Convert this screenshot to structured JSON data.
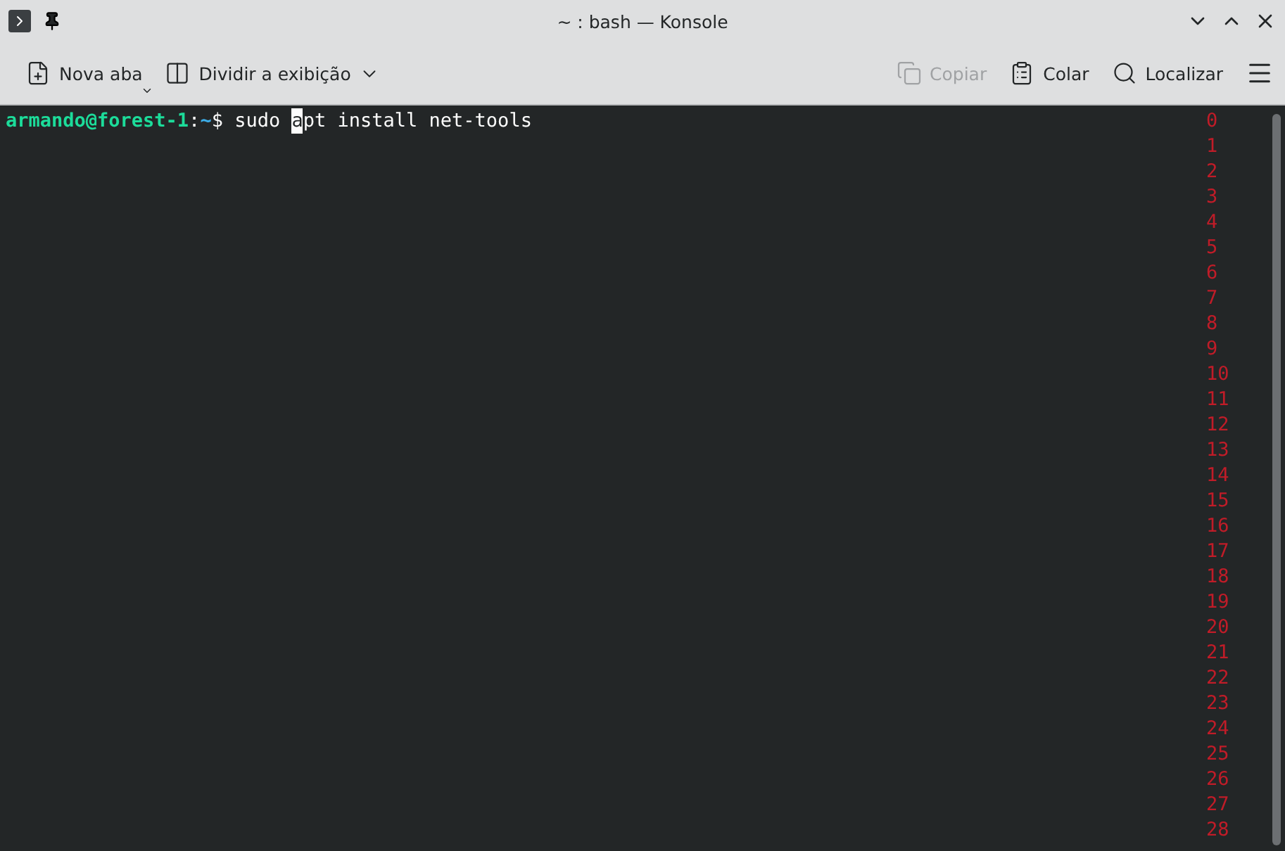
{
  "window": {
    "title": "~ : bash — Konsole"
  },
  "toolbar": {
    "left": [
      {
        "label": "Nova aba",
        "disabled": false,
        "kind": "corner"
      },
      {
        "label": "Dividir a exibição",
        "disabled": false,
        "kind": "side"
      }
    ],
    "right": [
      {
        "label": "Copiar",
        "disabled": true
      },
      {
        "label": "Colar",
        "disabled": false
      },
      {
        "label": "Localizar",
        "disabled": false
      }
    ]
  },
  "terminal": {
    "lines": [
      {
        "user_host": "armando@forest-1",
        "separator": ":",
        "path": "~",
        "symbol": "$",
        "before_cursor": " sudo ",
        "cursor_char": "a",
        "after_cursor": "pt install net-tools"
      }
    ],
    "row_numbers": [
      "0",
      "1",
      "2",
      "3",
      "4",
      "5",
      "6",
      "7",
      "8",
      "9",
      "10",
      "11",
      "12",
      "13",
      "14",
      "15",
      "16",
      "17",
      "18",
      "19",
      "20",
      "21",
      "22",
      "23",
      "24",
      "25",
      "26",
      "27",
      "28"
    ]
  }
}
